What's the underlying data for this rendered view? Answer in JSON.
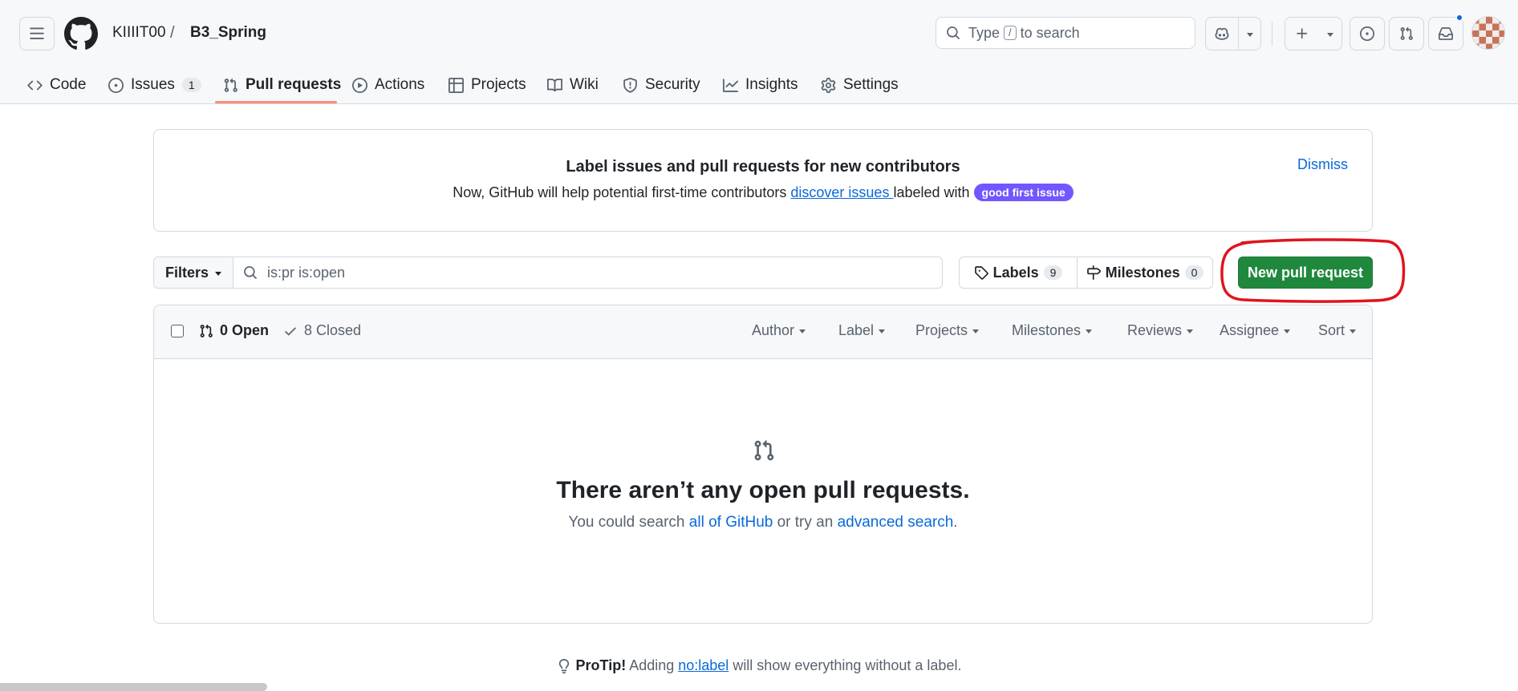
{
  "header": {
    "owner": "KIIIIT00",
    "separator": "/",
    "repo": "B3_Spring",
    "search": {
      "prefix": "Type",
      "key": "/",
      "suffix": "to search"
    }
  },
  "tabs": [
    {
      "label": "Code",
      "icon": "code-icon"
    },
    {
      "label": "Issues",
      "icon": "issue-opened-icon",
      "count": "1"
    },
    {
      "label": "Pull requests",
      "icon": "git-pull-request-icon",
      "selected": true
    },
    {
      "label": "Actions",
      "icon": "play-icon"
    },
    {
      "label": "Projects",
      "icon": "table-icon"
    },
    {
      "label": "Wiki",
      "icon": "book-icon"
    },
    {
      "label": "Security",
      "icon": "shield-icon"
    },
    {
      "label": "Insights",
      "icon": "graph-icon"
    },
    {
      "label": "Settings",
      "icon": "gear-icon"
    }
  ],
  "banner": {
    "title": "Label issues and pull requests for new contributors",
    "text_before": "Now, GitHub will help potential first-time contributors ",
    "link": "discover issues ",
    "text_after": "labeled with ",
    "label": "good first issue",
    "label_color": "#7057ff",
    "dismiss": "Dismiss"
  },
  "filters": {
    "button": "Filters",
    "query": "is:pr is:open",
    "labels": "Labels",
    "labels_count": "9",
    "milestones": "Milestones",
    "milestones_count": "0",
    "new_pr": "New pull request",
    "new_pr_color": "#1f883d"
  },
  "list": {
    "open": "0 Open",
    "closed": "8 Closed",
    "menus": [
      "Author",
      "Label",
      "Projects",
      "Milestones",
      "Reviews",
      "Assignee",
      "Sort"
    ]
  },
  "blankslate": {
    "title": "There aren’t any open pull requests.",
    "text1": "You could search ",
    "link1": "all of GitHub",
    "text2": " or try an ",
    "link2": "advanced search",
    "text3": "."
  },
  "protip": {
    "strong": "ProTip!",
    "text1": " Adding ",
    "link": "no:label",
    "text2": " will show everything without a label."
  },
  "annotation_color": "#e0141e"
}
